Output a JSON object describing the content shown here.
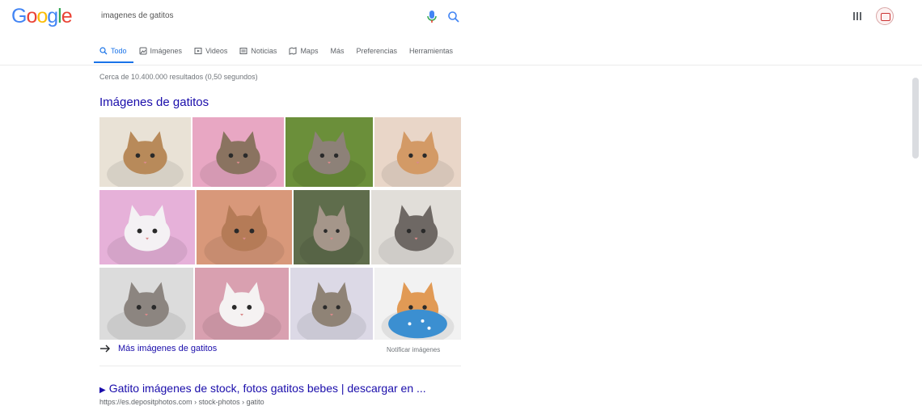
{
  "header": {
    "logo_letters": [
      {
        "ch": "G",
        "color": "#4285f4"
      },
      {
        "ch": "o",
        "color": "#ea4335"
      },
      {
        "ch": "o",
        "color": "#fbbc05"
      },
      {
        "ch": "g",
        "color": "#4285f4"
      },
      {
        "ch": "l",
        "color": "#34a853"
      },
      {
        "ch": "e",
        "color": "#ea4335"
      }
    ],
    "search_query": "imagenes de gatitos",
    "icons": [
      "microphone-icon",
      "search-icon",
      "apps-grid-icon",
      "account-avatar"
    ]
  },
  "tabs": [
    {
      "label": "Todo",
      "icon": "search-icon",
      "active": true
    },
    {
      "label": "Imágenes",
      "icon": "image-icon",
      "active": false
    },
    {
      "label": "Videos",
      "icon": "video-icon",
      "active": false
    },
    {
      "label": "Noticias",
      "icon": "news-icon",
      "active": false
    },
    {
      "label": "Maps",
      "icon": "map-icon",
      "active": false
    },
    {
      "label": "Más",
      "icon": "",
      "active": false
    },
    {
      "label": "Preferencias",
      "icon": "",
      "active": false
    },
    {
      "label": "Herramientas",
      "icon": "",
      "active": false
    }
  ],
  "stats": "Cerca de 10.400.000 resultados (0,50 segundos)",
  "image_section": {
    "title": "Imágenes de gatitos",
    "more_label": "Más imágenes de gatitos",
    "feedback_label": "Notificar imágenes",
    "thumbnails": [
      {
        "subject": "two kittens cuddling on white",
        "bg": "#e9e2d6",
        "fur": "#b88a5a"
      },
      {
        "subject": "tabby kitten on pink fabric",
        "bg": "#e8a7c3",
        "fur": "#8a7360"
      },
      {
        "subject": "tabby kitten on green grass",
        "bg": "#6b8f3a",
        "fur": "#8d8178"
      },
      {
        "subject": "ginger kitten lying on blanket",
        "bg": "#e9d6c8",
        "fur": "#d39a66"
      },
      {
        "subject": "two white kittens on pink",
        "bg": "#e6b1d9",
        "fur": "#f4f1f4"
      },
      {
        "subject": "tabby kitten with raised paws",
        "bg": "#d8987a",
        "fur": "#b57b57"
      },
      {
        "subject": "tabby kitten on green background",
        "bg": "#5f6d4c",
        "fur": "#a5968a"
      },
      {
        "subject": "grey kitten stretching on blanket",
        "bg": "#e1ded9",
        "fur": "#6e6864"
      },
      {
        "subject": "three grey kittens",
        "bg": "#dcdcdc",
        "fur": "#8c8580"
      },
      {
        "subject": "white kitten sleeping on pink",
        "bg": "#d9a0b0",
        "fur": "#f5f2f2"
      },
      {
        "subject": "grey tabby kitten curled up",
        "bg": "#dcd9e6",
        "fur": "#8f8376"
      },
      {
        "subject": "orange kitten in blue teacup",
        "bg": "#f2f2f2",
        "fur": "#e19a55"
      }
    ]
  },
  "first_result": {
    "title": "Gatito imágenes de stock, fotos gatitos bebes | descargar en ...",
    "url": "https://es.depositphotos.com › stock-photos › gatito"
  }
}
